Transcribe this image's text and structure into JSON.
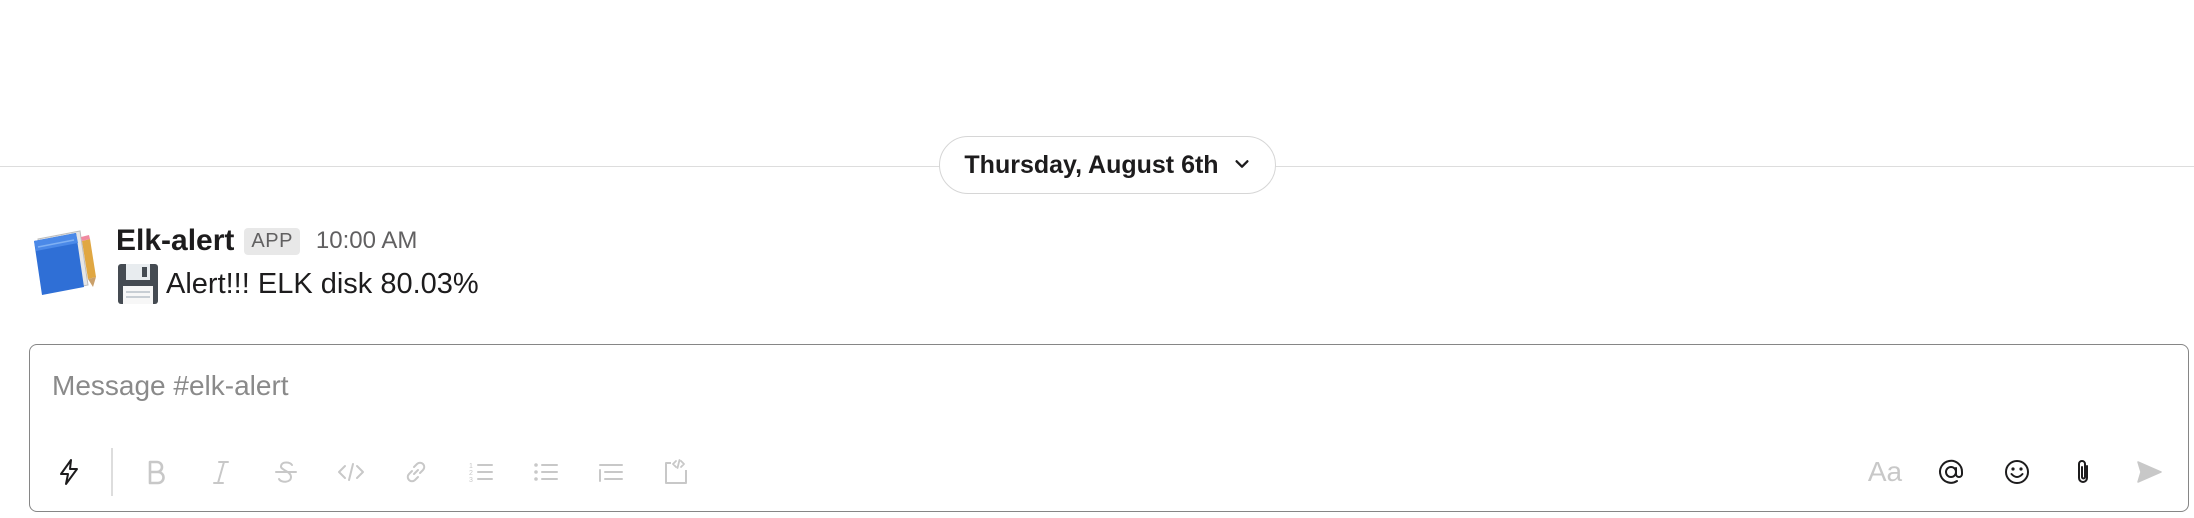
{
  "divider": {
    "date_label": "Thursday, August 6th"
  },
  "message": {
    "sender": "Elk-alert",
    "badge": "APP",
    "time": "10:00 AM",
    "emoji_icon": "floppy-disk-icon",
    "text": "Alert!!! ELK disk 80.03%"
  },
  "composer": {
    "placeholder": "Message #elk-alert",
    "value": "",
    "format_buttons": [
      "shortcuts",
      "bold",
      "italic",
      "strikethrough",
      "code",
      "link",
      "ordered-list",
      "bulleted-list",
      "blockquote",
      "code-block"
    ],
    "right_buttons": {
      "formatting_label": "Aa",
      "mention": "at-sign-icon",
      "emoji": "emoji-icon",
      "attach": "paperclip-icon",
      "send": "send-icon"
    }
  },
  "colors": {
    "divider": "#dddddd",
    "text": "#1d1c1d",
    "muted": "#616061",
    "disabled_icon": "#c8c8c8",
    "active_icon": "#1d1c1d",
    "badge_bg": "#e8e8e8"
  }
}
